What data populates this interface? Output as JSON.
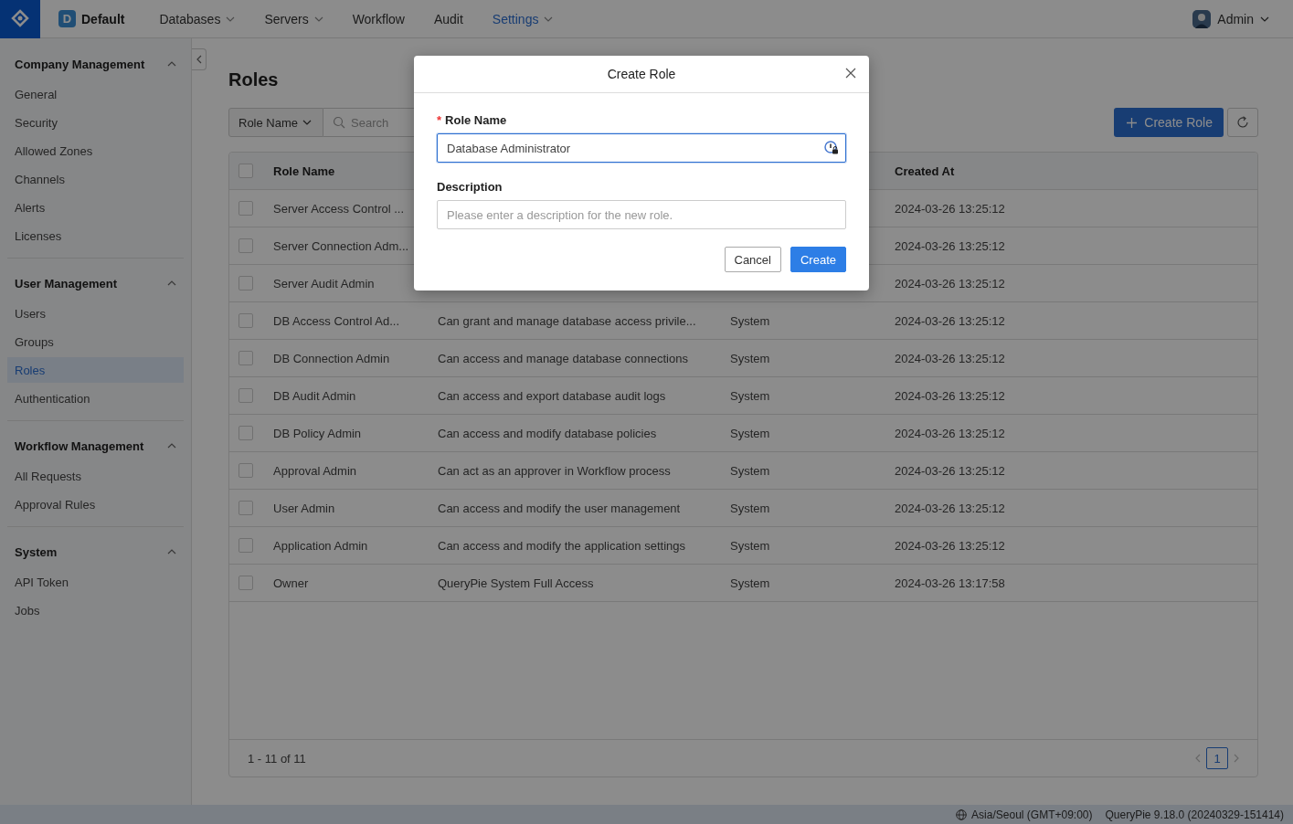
{
  "topbar": {
    "workspace_badge": "D",
    "workspace": "Default",
    "nav": [
      {
        "label": "Databases",
        "selected": false,
        "dropdown": true
      },
      {
        "label": "Servers",
        "selected": false,
        "dropdown": true
      },
      {
        "label": "Workflow",
        "selected": false,
        "dropdown": false
      },
      {
        "label": "Audit",
        "selected": false,
        "dropdown": false
      },
      {
        "label": "Settings",
        "selected": true,
        "dropdown": true
      }
    ],
    "user": "Admin"
  },
  "sidebar": {
    "groups": [
      {
        "title": "Company Management",
        "expanded": true,
        "items": [
          {
            "label": "General",
            "selected": false
          },
          {
            "label": "Security",
            "selected": false
          },
          {
            "label": "Allowed Zones",
            "selected": false
          },
          {
            "label": "Channels",
            "selected": false
          },
          {
            "label": "Alerts",
            "selected": false
          },
          {
            "label": "Licenses",
            "selected": false
          }
        ]
      },
      {
        "title": "User Management",
        "expanded": true,
        "items": [
          {
            "label": "Users",
            "selected": false
          },
          {
            "label": "Groups",
            "selected": false
          },
          {
            "label": "Roles",
            "selected": true
          },
          {
            "label": "Authentication",
            "selected": false
          }
        ]
      },
      {
        "title": "Workflow Management",
        "expanded": true,
        "items": [
          {
            "label": "All Requests",
            "selected": false
          },
          {
            "label": "Approval Rules",
            "selected": false
          }
        ]
      },
      {
        "title": "System",
        "expanded": true,
        "items": [
          {
            "label": "API Token",
            "selected": false
          },
          {
            "label": "Jobs",
            "selected": false
          }
        ]
      }
    ]
  },
  "page": {
    "title": "Roles",
    "filter": "Role Name",
    "search_placeholder": "Search",
    "create_button": "Create Role"
  },
  "table": {
    "columns": [
      "Role Name",
      "Created At"
    ],
    "rows": [
      {
        "role_name": "Server Access Control ...",
        "created_at": "2024-03-26 13:25:12",
        "checked": false
      },
      {
        "role_name": "Server Connection Adm...",
        "created_at": "2024-03-26 13:25:12",
        "checked": false
      },
      {
        "role_name": "Server Audit Admin",
        "created_at": "2024-03-26 13:25:12",
        "checked": false
      },
      {
        "role_name": "DB Access Control Ad...",
        "description": "Can grant and manage database access privile...",
        "type": "System",
        "created_at": "2024-03-26 13:25:12",
        "checked": false
      },
      {
        "role_name": "DB Connection Admin",
        "description": "Can access and manage database connections",
        "type": "System",
        "created_at": "2024-03-26 13:25:12",
        "checked": false
      },
      {
        "role_name": "DB Audit Admin",
        "description": "Can access and export database audit logs",
        "type": "System",
        "created_at": "2024-03-26 13:25:12",
        "checked": false
      },
      {
        "role_name": "DB Policy Admin",
        "description": "Can access and modify database policies",
        "type": "System",
        "created_at": "2024-03-26 13:25:12",
        "checked": false
      },
      {
        "role_name": "Approval Admin",
        "description": "Can act as an approver in Workflow process",
        "type": "System",
        "created_at": "2024-03-26 13:25:12",
        "checked": false
      },
      {
        "role_name": "User Admin",
        "description": "Can access and modify the user management",
        "type": "System",
        "created_at": "2024-03-26 13:25:12",
        "checked": false
      },
      {
        "role_name": "Application Admin",
        "description": "Can access and modify the application settings",
        "type": "System",
        "created_at": "2024-03-26 13:25:12",
        "checked": false
      },
      {
        "role_name": "Owner",
        "description": "QueryPie System Full Access",
        "type": "System",
        "created_at": "2024-03-26 13:17:58",
        "checked": false
      }
    ],
    "all_checked": false,
    "range": "1 - 11 of 11",
    "pages": [
      {
        "label": "1",
        "selected": true
      }
    ]
  },
  "modal": {
    "title": "Create Role",
    "fields": [
      {
        "label": "Role Name",
        "required_mark": "*",
        "value": "Database Administrator",
        "focused": true
      },
      {
        "label": "Description",
        "placeholder": "Please enter a description for the new role.",
        "focused": false
      }
    ],
    "buttons": [
      {
        "label": "Cancel",
        "kind": "secondary"
      },
      {
        "label": "Create",
        "kind": "primary"
      }
    ]
  },
  "status_bar": {
    "timezone": "Asia/Seoul (GMT+09:00)",
    "version": "QueryPie 9.18.0 (20240329-151414)"
  }
}
